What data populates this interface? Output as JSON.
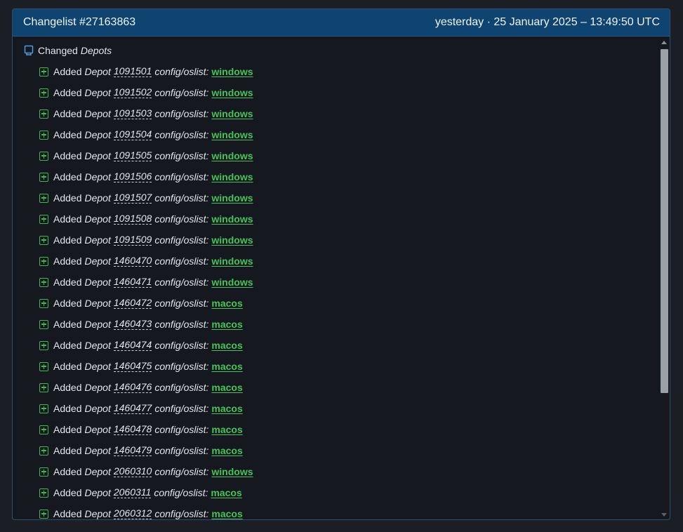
{
  "header": {
    "title": "Changelist #27163863",
    "timestamp": "yesterday · 25 January 2025 – 13:49:50 UTC"
  },
  "group": {
    "icon": "depot-icon",
    "prefix": "Changed",
    "name": "Depots"
  },
  "labels": {
    "added": "Added",
    "depot": "Depot",
    "key": "config/oslist:"
  },
  "colors": {
    "header_bg": "#0f4470",
    "accent_green": "#46c35a",
    "background": "#15181e"
  },
  "rows": [
    {
      "id": "1091501",
      "os": "windows"
    },
    {
      "id": "1091502",
      "os": "windows"
    },
    {
      "id": "1091503",
      "os": "windows"
    },
    {
      "id": "1091504",
      "os": "windows"
    },
    {
      "id": "1091505",
      "os": "windows"
    },
    {
      "id": "1091506",
      "os": "windows"
    },
    {
      "id": "1091507",
      "os": "windows"
    },
    {
      "id": "1091508",
      "os": "windows"
    },
    {
      "id": "1091509",
      "os": "windows"
    },
    {
      "id": "1460470",
      "os": "windows"
    },
    {
      "id": "1460471",
      "os": "windows"
    },
    {
      "id": "1460472",
      "os": "macos"
    },
    {
      "id": "1460473",
      "os": "macos"
    },
    {
      "id": "1460474",
      "os": "macos"
    },
    {
      "id": "1460475",
      "os": "macos"
    },
    {
      "id": "1460476",
      "os": "macos"
    },
    {
      "id": "1460477",
      "os": "macos"
    },
    {
      "id": "1460478",
      "os": "macos"
    },
    {
      "id": "1460479",
      "os": "macos"
    },
    {
      "id": "2060310",
      "os": "windows"
    },
    {
      "id": "2060311",
      "os": "macos"
    },
    {
      "id": "2060312",
      "os": "macos"
    }
  ]
}
